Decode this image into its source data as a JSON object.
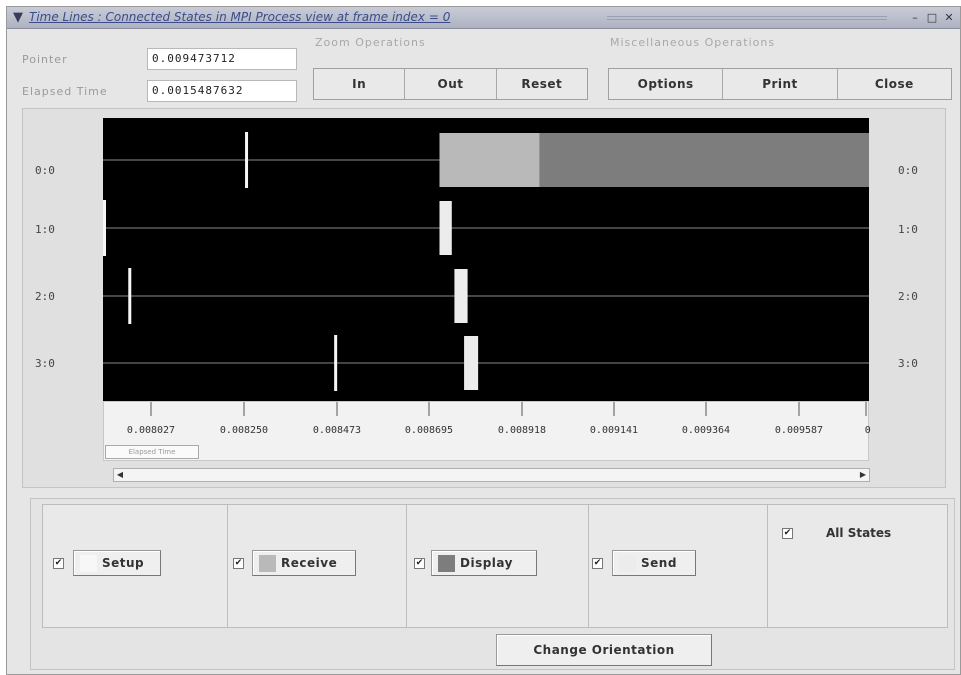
{
  "window": {
    "title": "Time Lines : Connected States in MPI Process view at frame index = 0",
    "menu_icon": "chevron-down-icon",
    "controls": {
      "minimize": "–",
      "maximize": "□",
      "close": "✕"
    }
  },
  "info": {
    "pointer_label": "Pointer",
    "pointer_value": "0.009473712",
    "elapsed_label": "Elapsed Time",
    "elapsed_value": "0.0015487632"
  },
  "zoom": {
    "title": "Zoom Operations",
    "buttons": [
      "In",
      "Out",
      "Reset"
    ]
  },
  "misc": {
    "title": "Miscellaneous Operations",
    "buttons": [
      "Options",
      "Print",
      "Close"
    ]
  },
  "timeline": {
    "rows": [
      "0:0",
      "1:0",
      "2:0",
      "3:0"
    ],
    "x_ticks": [
      "0.008027",
      "0.008250",
      "0.008473",
      "0.008695",
      "0.008918",
      "0.009141",
      "0.009364",
      "0.009587",
      "0"
    ],
    "axis_title": "Elapsed Time",
    "x_start": 0.0079267,
    "x_end": 0.0096718,
    "states": [
      {
        "row": 0,
        "type": "setup",
        "start": 0.0082503,
        "end": 0.0082503
      },
      {
        "row": 0,
        "type": "receive",
        "start": 0.0086933,
        "end": 0.0089213
      },
      {
        "row": 0,
        "type": "display",
        "start": 0.0089213,
        "end": 0.0096718
      },
      {
        "row": 1,
        "type": "setup",
        "start": 0.0079267,
        "end": 0.0079267
      },
      {
        "row": 1,
        "type": "send",
        "start": 0.0086933,
        "end": 0.0087213
      },
      {
        "row": 2,
        "type": "setup",
        "start": 0.0079843,
        "end": 0.0079843
      },
      {
        "row": 2,
        "type": "send",
        "start": 0.0087273,
        "end": 0.0087573
      },
      {
        "row": 3,
        "type": "setup",
        "start": 0.0084533,
        "end": 0.0084533
      },
      {
        "row": 3,
        "type": "send",
        "start": 0.0087493,
        "end": 0.0087813
      }
    ]
  },
  "legend": {
    "states": [
      {
        "label": "Setup",
        "color": "#f7f7f7",
        "checked": true
      },
      {
        "label": "Receive",
        "color": "#b9b9b9",
        "checked": true
      },
      {
        "label": "Display",
        "color": "#7d7d7d",
        "checked": true
      },
      {
        "label": "Send",
        "color": "#ececec",
        "checked": true
      }
    ],
    "all_states_label": "All States",
    "all_states_checked": true,
    "change_orientation": "Change Orientation"
  },
  "colors": {
    "canvas_bg": "#000000",
    "timeline_line": "#8a8a8a",
    "setup": "#f7f7f7",
    "receive": "#b9b9b9",
    "display": "#7d7d7d",
    "send": "#ececec"
  }
}
